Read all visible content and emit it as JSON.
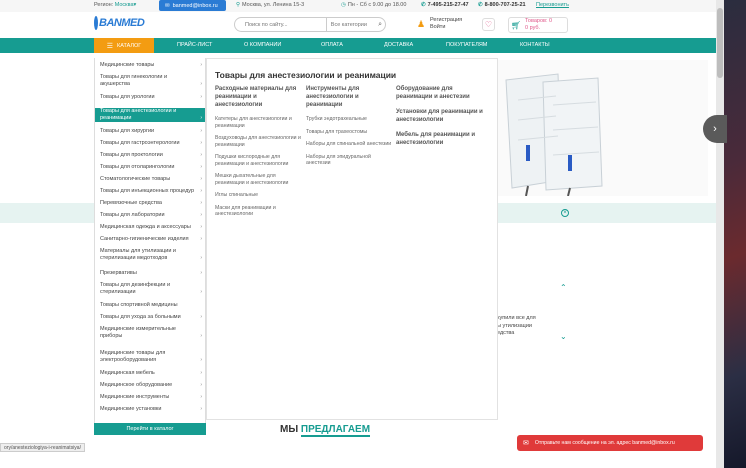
{
  "topbar": {
    "region_label": "Регион:",
    "region_city": "Москва",
    "email": "banmed@inbox.ru",
    "address": "Москва, ул. Ленина 15-3",
    "hours": "Пн - Сб с 9.00 до 18.00",
    "phone1": "7-495-215-27-47",
    "phone2": "8-800-707-25-21",
    "callback": "Перезвонить"
  },
  "header": {
    "logo_text": "BANMED",
    "search_placeholder": "Поиск по сайту...",
    "search_category": "Все категории",
    "register": "Регистрация",
    "login": "Войти",
    "cart_items": "Товаров: 0",
    "cart_sum": "0 руб."
  },
  "nav": {
    "catalog": "КАТАЛОГ",
    "items": [
      "ПРАЙС-ЛИСТ",
      "О КОМПАНИИ",
      "ОПЛАТА",
      "ДОСТАВКА",
      "ПОКУПАТЕЛЯМ",
      "КОНТАКТЫ"
    ]
  },
  "sidebar": {
    "items": [
      {
        "label": "Медицинские товары",
        "chevron": true
      },
      {
        "label": "Товары для гинекологии и акушерства",
        "chevron": true
      },
      {
        "label": "Товары для урологии",
        "chevron": true
      },
      {
        "label": "Товары для анестезиологии и реанимации",
        "chevron": true,
        "active": true
      },
      {
        "label": "Товары для хирургии",
        "chevron": true
      },
      {
        "label": "Товары для гастроэнтерологии",
        "chevron": true
      },
      {
        "label": "Товары для проктологии",
        "chevron": true
      },
      {
        "label": "Товары для отоларингологии",
        "chevron": true
      },
      {
        "label": "Стоматологические товары",
        "chevron": true
      },
      {
        "label": "Товары для инъекционных процедур",
        "chevron": true
      },
      {
        "label": "Перевязочные средства",
        "chevron": true
      },
      {
        "label": "Товары для лаборатории",
        "chevron": true
      },
      {
        "label": "Медицинская одежда и аксессуары",
        "chevron": true
      },
      {
        "label": "Санитарно-гигиенические изделия",
        "chevron": true
      },
      {
        "label": "Материалы для утилизации и стерилизации медотходов",
        "chevron": true
      },
      {
        "label": "Презервативы",
        "chevron": true
      },
      {
        "label": "Товары для дезинфекции и стерилизации",
        "chevron": true
      },
      {
        "label": "Товары спортивной медицины",
        "chevron": false
      },
      {
        "label": "Товары для ухода за больными",
        "chevron": true
      },
      {
        "label": "Медицинские измерительные приборы",
        "chevron": true
      },
      {
        "label": "Медицинские товары для электрооборудования",
        "chevron": true
      },
      {
        "label": "Медицинская мебель",
        "chevron": true
      },
      {
        "label": "Медицинское оборудование",
        "chevron": true
      },
      {
        "label": "Медицинские инструменты",
        "chevron": true
      },
      {
        "label": "Медицинские установки",
        "chevron": true
      }
    ],
    "goto_catalog": "Перейти в каталог"
  },
  "panel": {
    "title": "Товары для анестезиологии и реанимации",
    "columns": [
      {
        "heading": "Расходные материалы для реанимации и анестезиологии",
        "links": [
          "Катетеры для анестезиологии и реанимации",
          "Воздуховоды для анестезиологии и реанимации",
          "Подушки кислородные для реанимации и анестезиологии",
          "Мешки дыхательные для реанимации и анестезиологии",
          "Иглы спинальные",
          "Маски для реанимации и анестезиологии"
        ]
      },
      {
        "heading": "Инструменты для анестезиологии и реанимации",
        "links": [
          "Трубки эндотрахеальные",
          "Товары для трахеостомы",
          "Наборы для спинальной анестезии",
          "Наборы для эпидуральной анестезии"
        ]
      },
      {
        "heading": "Оборудование для реанимации и анестезии",
        "links": []
      }
    ],
    "extra_headings": [
      "Установки для реанимации и анестезиологии",
      "Мебель для реанимации и анестезиологии"
    ]
  },
  "background": {
    "text_lines": [
      "купили все для",
      "ы утилизации",
      "едства"
    ],
    "offer_plain": "МЫ ",
    "offer_highlight": "ПРЕДЛАГАЕМ",
    "status_url": "ory/anesteziologiya-i-reanimatsiya/"
  },
  "chat": {
    "message": "Отправьте нам сообщение на эл. адрес banmed@inbox.ru"
  },
  "colors": {
    "teal": "#169c91",
    "orange": "#f39c12",
    "blue": "#2a7bd4",
    "chat_red": "#e03a3a"
  }
}
